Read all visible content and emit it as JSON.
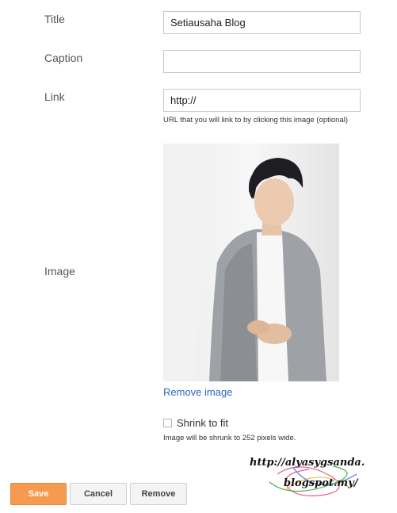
{
  "form": {
    "title_label": "Title",
    "title_value": "Setiausaha Blog",
    "caption_label": "Caption",
    "caption_value": "",
    "link_label": "Link",
    "link_value": "http://",
    "link_help": "URL that you will link to by clicking this image (optional)",
    "image_label": "Image",
    "remove_image": "Remove image",
    "shrink_label": "Shrink to fit",
    "shrink_checked": false,
    "shrink_help": "Image will be shrunk to 252 pixels wide."
  },
  "buttons": {
    "save": "Save",
    "cancel": "Cancel",
    "remove": "Remove"
  },
  "watermark": {
    "line1": "http://alyasygsanda.",
    "line2": "blogspot.my/"
  },
  "colors": {
    "save_button": "#f59a4e",
    "link": "#3366bb"
  }
}
